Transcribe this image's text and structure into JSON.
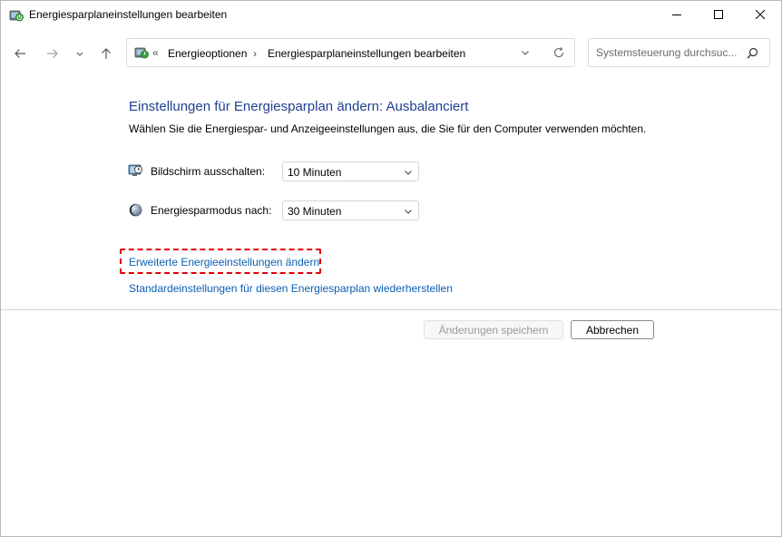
{
  "window": {
    "title": "Energiesparplaneinstellungen bearbeiten",
    "app_icon": "power-options-icon",
    "controls": {
      "minimize_icon": "minimize-icon",
      "maximize_icon": "maximize-icon",
      "close_icon": "close-icon"
    }
  },
  "navigation": {
    "back_icon": "arrow-left-icon",
    "forward_icon": "arrow-right-icon",
    "recent_icon": "chevron-down-icon",
    "up_icon": "arrow-up-icon",
    "breadcrumb": {
      "icon": "power-options-icon",
      "overflow": "«",
      "separator": "›",
      "items": [
        "Energieoptionen",
        "Energiesparplaneinstellungen bearbeiten"
      ]
    },
    "refresh_icon": "refresh-icon",
    "search": {
      "placeholder": "Systemsteuerung durchsuc...",
      "icon": "search-icon"
    }
  },
  "content": {
    "title": "Einstellungen für Energiesparplan ändern: Ausbalanciert",
    "description": "Wählen Sie die Energiespar- und Anzeigeeinstellungen aus, die Sie für den Computer verwenden möchten.",
    "settings": [
      {
        "label": "Bildschirm ausschalten:",
        "value": "10 Minuten",
        "icon": "display-clock-icon"
      },
      {
        "label": "Energiesparmodus nach:",
        "value": "30 Minuten",
        "icon": "sleep-moon-icon"
      }
    ],
    "links": {
      "advanced": "Erweiterte Energieeinstellungen ändern",
      "restore": "Standardeinstellungen für diesen Energiesparplan wiederherstellen"
    },
    "highlight_color": "#e00000"
  },
  "footer": {
    "save_label": "Änderungen speichern",
    "save_enabled": false,
    "cancel_label": "Abbrechen"
  },
  "colors": {
    "title_blue": "#1e3f91",
    "link_blue": "#0a5fb4"
  }
}
